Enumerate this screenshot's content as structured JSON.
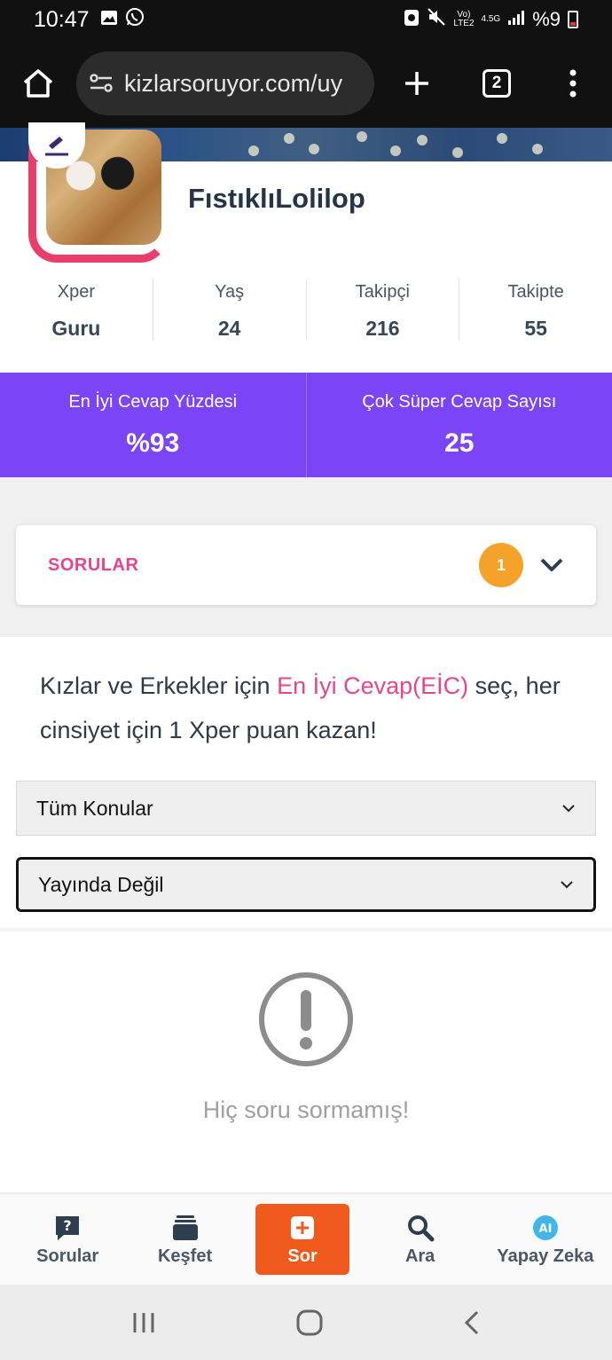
{
  "status_bar": {
    "time": "10:47",
    "network_label_top": "Vo)",
    "network_label_bottom": "LTE2",
    "net_speed": "4.5G",
    "battery_text": "%9"
  },
  "browser": {
    "url": "kizlarsoruyor.com/uy",
    "tab_count": "2"
  },
  "profile": {
    "username": "FıstıklıLolilop",
    "stats": [
      {
        "label": "Xper",
        "value": "Guru"
      },
      {
        "label": "Yaş",
        "value": "24"
      },
      {
        "label": "Takipçi",
        "value": "216"
      },
      {
        "label": "Takipte",
        "value": "55"
      }
    ],
    "highlights": [
      {
        "label": "En İyi Cevap Yüzdesi",
        "value": "%93"
      },
      {
        "label": "Çok Süper Cevap Sayısı",
        "value": "25"
      }
    ]
  },
  "sorular": {
    "title": "SORULAR",
    "count": "1"
  },
  "promo": {
    "text_before": "Kızlar ve Erkekler için ",
    "highlight": "En İyi Cevap(EİC)",
    "text_after": " seç, her cinsiyet için 1 Xper puan kazan!"
  },
  "filters": {
    "topic_selected": "Tüm Konular",
    "status_selected": "Yayında Değil"
  },
  "empty_state": {
    "message": "Hiç soru sormamış!"
  },
  "bottom_nav": {
    "items": [
      {
        "label": "Sorular",
        "icon": "question-bubble-icon"
      },
      {
        "label": "Keşfet",
        "icon": "cards-stack-icon"
      },
      {
        "label": "Sor",
        "icon": "plus-square-icon"
      },
      {
        "label": "Ara",
        "icon": "search-icon"
      },
      {
        "label": "Yapay Zeka",
        "icon": "ai-icon"
      }
    ],
    "ai_badge": "AI"
  },
  "colors": {
    "accent_pink": "#e6458e",
    "purple": "#7b45f5",
    "orange": "#f05a1c",
    "badge_orange": "#f5a22b"
  }
}
